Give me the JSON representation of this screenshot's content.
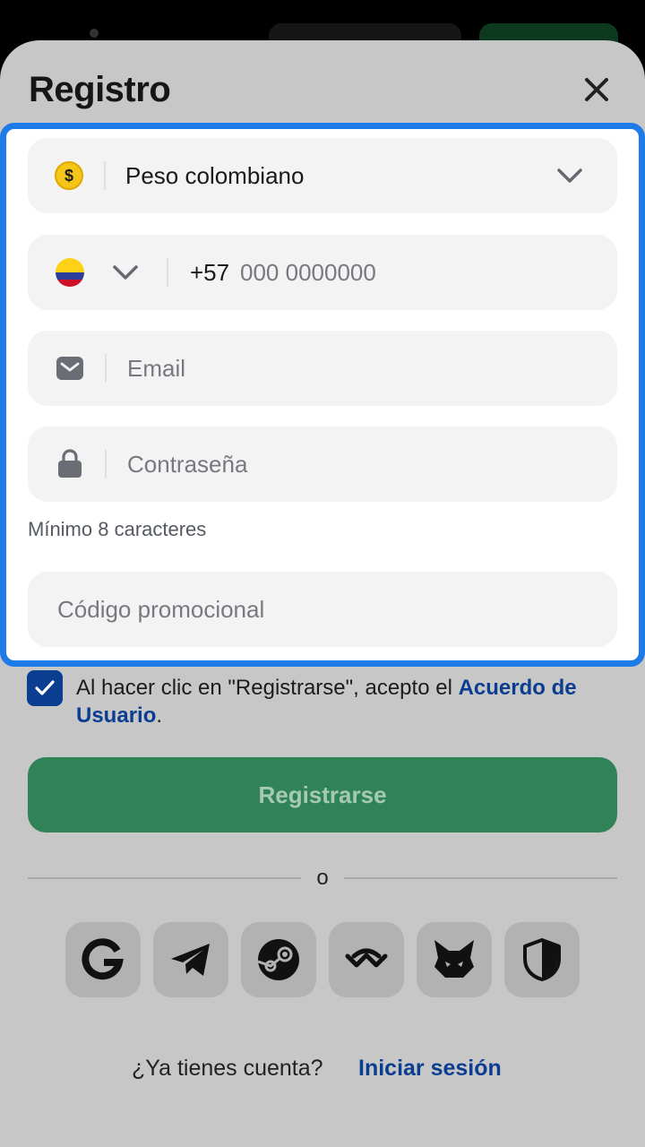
{
  "header": {
    "title": "Registro"
  },
  "form": {
    "currency_value": "Peso colombiano",
    "currency_icon": "$",
    "phone_prefix": "+57",
    "phone_placeholder": "000 0000000",
    "email_placeholder": "Email",
    "password_placeholder": "Contraseña",
    "password_hint": "Mínimo 8 caracteres",
    "promo_placeholder": "Código promocional"
  },
  "consent": {
    "text": "Al hacer clic en \"Registrarse\", acepto el ",
    "link": "Acuerdo de Usuario",
    "suffix": ".",
    "checked": true
  },
  "register_button": "Registrarse",
  "divider": "o",
  "social": [
    "google-icon",
    "telegram-icon",
    "steam-icon",
    "walletconnect-icon",
    "metamask-icon",
    "shield-icon"
  ],
  "footer": {
    "question": "¿Ya tienes cuenta?",
    "login_link": "Iniciar sesión"
  },
  "colors": {
    "accent_blue": "#1c7be8",
    "brand_green": "#2f8356",
    "link_blue": "#0b3d91"
  }
}
